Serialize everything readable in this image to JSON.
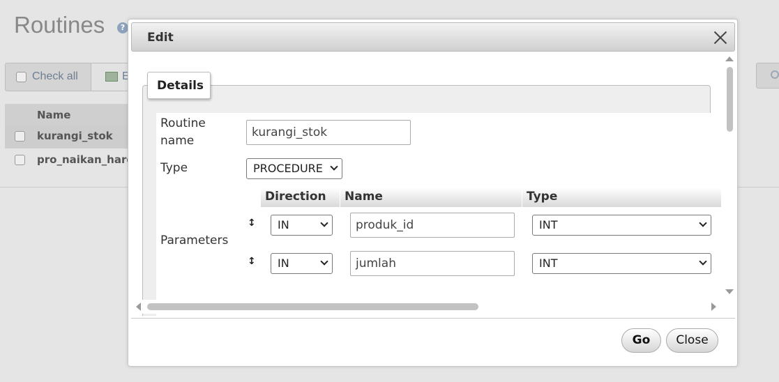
{
  "background": {
    "page_title": "Routines",
    "help_icon": "?",
    "toolbar": {
      "check_all_label": "Check all",
      "export_label": "E"
    },
    "table": {
      "header": "Name",
      "rows": [
        "kurangi_stok",
        "pro_naikan_harg"
      ]
    }
  },
  "dialog": {
    "title": "Edit",
    "tab": "Details",
    "routine_name_label_line1": "Routine",
    "routine_name_label_line2": "name",
    "routine_name_value": "kurangi_stok",
    "type_label": "Type",
    "type_value": "PROCEDURE",
    "parameters_label": "Parameters",
    "param_headers": {
      "direction": "Direction",
      "name": "Name",
      "type": "Type"
    },
    "params": [
      {
        "direction": "IN",
        "name": "produk_id",
        "type": "INT"
      },
      {
        "direction": "IN",
        "name": "jumlah",
        "type": "INT"
      }
    ],
    "drag_glyph": "↕",
    "go_button": "Go",
    "close_button": "Close"
  },
  "icons": {
    "close": "close-icon",
    "export": "export-icon",
    "search": "search-icon",
    "help": "help-icon"
  }
}
